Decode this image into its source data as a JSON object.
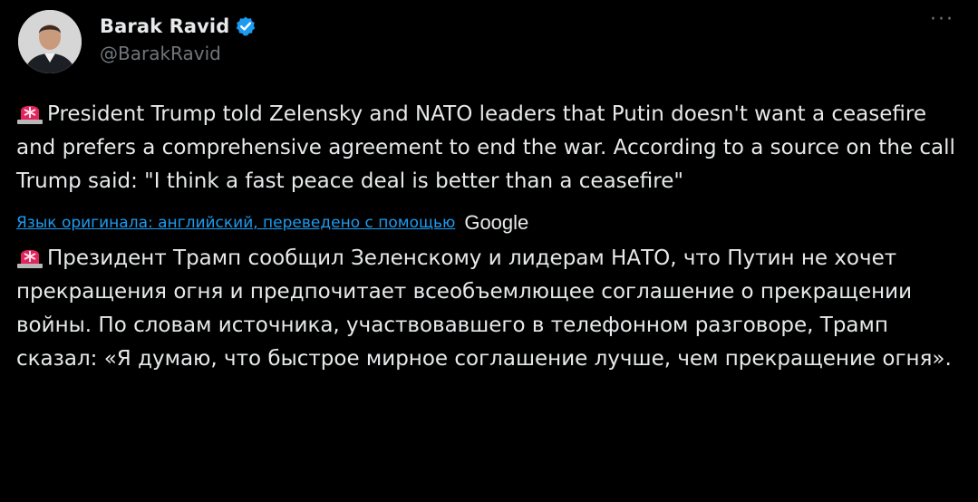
{
  "author": {
    "display_name": "Barak Ravid",
    "handle": "@BarakRavid",
    "verified": true
  },
  "icons": {
    "verified": "verified-badge-icon",
    "more": "more-options-icon",
    "siren": "siren-emoji-icon"
  },
  "colors": {
    "background": "#000000",
    "text": "#e7e9ea",
    "secondary": "#71767b",
    "link": "#1d9bf0",
    "verified": "#1d9bf0",
    "siren": "#e0245e"
  },
  "more_glyph": "···",
  "post": {
    "text": "President Trump told Zelensky and NATO leaders that Putin doesn't want a ceasefire and prefers a comprehensive agreement to end the war. According to a source on the call Trump said: \"I think a fast peace deal is better than a ceasefire\""
  },
  "translation_notice": {
    "link_text": "Язык оригинала: английский, переведено с помощью",
    "provider": "Google"
  },
  "translation": {
    "text": "Президент Трамп сообщил Зеленскому и лидерам НАТО, что Путин не хочет прекращения огня и предпочитает всеобъемлющее соглашение о прекращении войны. По словам источника, участвовавшего в телефонном разговоре, Трамп сказал: «Я думаю, что быстрое мирное соглашение лучше, чем прекращение огня»."
  }
}
